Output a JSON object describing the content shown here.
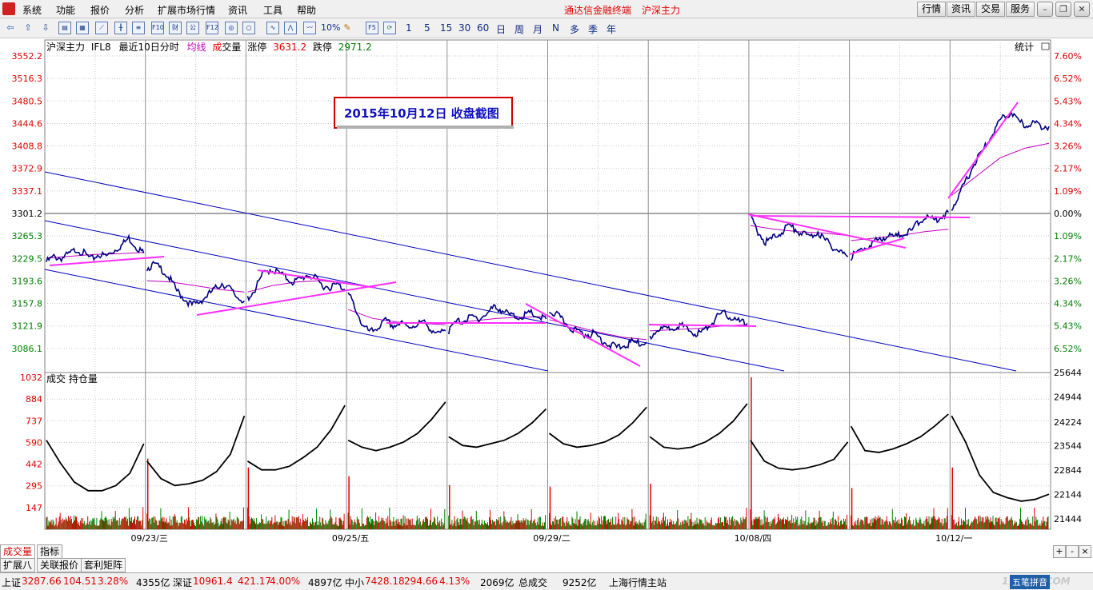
{
  "menu": {
    "items": [
      "系统",
      "功能",
      "报价",
      "分析",
      "扩展市场行情",
      "资讯",
      "工具",
      "帮助"
    ],
    "app_title": "通达信金融终端",
    "instrument_title": "沪深主力",
    "right_tabs": [
      "行情",
      "资讯",
      "交易",
      "服务"
    ]
  },
  "toolbar": {
    "icons": [
      "back-icon",
      "up-arrow-icon",
      "down-arrow-icon",
      "report-icon",
      "grid-icon",
      "trend-icon",
      "candlestick-icon",
      "f10-icon",
      "fin-icon",
      "formula-icon",
      "f12-icon",
      "xuan-icon",
      "tick-icon",
      "line-chart-icon",
      "mountain-chart-icon",
      "wave-chart-icon",
      "percent-icon",
      "pencil-icon",
      "f5-icon",
      "refresh-icon"
    ],
    "icon_text": {
      "f10": "F10",
      "fin": "财",
      "f11": "公",
      "f12": "F12",
      "percent": "10%",
      "f5": "F5"
    },
    "periods": [
      "1",
      "5",
      "15",
      "30",
      "60",
      "日",
      "周",
      "月",
      "N",
      "多",
      "季",
      "年"
    ]
  },
  "chart_header": {
    "name": "沪深主力",
    "code": "IFL8",
    "mode": "最近10日分时",
    "avg_label": "均线",
    "vol_label_1": "成",
    "vol_label_2": "交量",
    "limit_up_label": "涨停",
    "limit_up": "3631.2",
    "limit_down_label": "跌停",
    "limit_down": "2971.2",
    "stats_label": "统计"
  },
  "annotation": "2015年10月12日  收盘截图",
  "lower_header": "成交 持仓量",
  "tabs_bottom": [
    "成交量",
    "指标"
  ],
  "tabs_bottom2": [
    "扩展八",
    "关联报价",
    "套利矩阵"
  ],
  "scroll_buttons": [
    "+",
    "-",
    "×"
  ],
  "status": {
    "sh_label": "上证",
    "sh_value": "3287.66",
    "sh_change": "104.51",
    "sh_pct": "3.28%",
    "sh_amount": "4355亿",
    "sz_label": "深证",
    "sz_value": "10961.4",
    "sz_change": "421.17",
    "sz_pct": "4.00%",
    "sz_amount": "4897亿",
    "zx_label": "中小",
    "zx_value": "7428.18",
    "zx_change": "294.66",
    "zx_pct": "4.13%",
    "zx_amount": "2069亿",
    "total_label": "总成交",
    "total_amount": "9252亿",
    "server": "上海行情主站",
    "ime": "五笔拼音",
    "watermark": "178448.COM"
  },
  "colors": {
    "up": "#e00000",
    "down": "#008000",
    "price_line": "#000080",
    "avg_line": "#c000c0",
    "trend_line": "#ff30ff",
    "channel": "#0000c0"
  },
  "chart_data": {
    "type": "line",
    "price_axis": {
      "ticks": [
        "3552.2",
        "3516.3",
        "3480.5",
        "3444.6",
        "3408.8",
        "3372.9",
        "3337.1",
        "3301.2",
        "3265.3",
        "3229.5",
        "3193.6",
        "3157.8",
        "3121.9",
        "3086.1"
      ],
      "ylim": [
        3050.2,
        3552.2
      ],
      "reference": 3301.2
    },
    "pct_axis": {
      "ticks": [
        "7.60%",
        "6.52%",
        "5.43%",
        "4.34%",
        "3.26%",
        "2.17%",
        "1.09%",
        "0.00%",
        "1.09%",
        "2.17%",
        "3.26%",
        "4.34%",
        "5.43%",
        "6.52%"
      ]
    },
    "volume_axis": {
      "ticks": [
        "1032",
        "884",
        "737",
        "590",
        "442",
        "295",
        "147"
      ],
      "ylim": [
        0,
        1032
      ]
    },
    "oi_axis": {
      "ticks": [
        "25644",
        "24944",
        "24224",
        "23544",
        "22844",
        "22144",
        "21444"
      ],
      "ylim": [
        21144,
        25644
      ]
    },
    "x_labels": [
      "09/23/三",
      "09/25/五",
      "09/29/二",
      "10/08/四",
      "10/12/一"
    ],
    "days": [
      "09/22",
      "09/23",
      "09/24",
      "09/25",
      "09/28",
      "09/29",
      "09/30",
      "10/08",
      "10/09",
      "10/12"
    ],
    "series": [
      {
        "name": "price",
        "values": [
          [
            3224,
            3232,
            3230,
            3236,
            3244,
            3238,
            3228,
            3236,
            3233,
            3242,
            3250,
            3262,
            3248,
            3238
          ],
          [
            3214,
            3220,
            3212,
            3198,
            3178,
            3165,
            3155,
            3160,
            3170,
            3180,
            3190,
            3182,
            3168,
            3162
          ],
          [
            3166,
            3180,
            3204,
            3212,
            3208,
            3200,
            3192,
            3196,
            3204,
            3198,
            3186,
            3184,
            3188,
            3180
          ],
          [
            3174,
            3150,
            3120,
            3112,
            3120,
            3130,
            3122,
            3126,
            3120,
            3124,
            3128,
            3118,
            3108,
            3114
          ],
          [
            3114,
            3128,
            3130,
            3136,
            3134,
            3140,
            3152,
            3148,
            3140,
            3136,
            3138,
            3142,
            3136,
            3133
          ],
          [
            3146,
            3140,
            3128,
            3118,
            3112,
            3108,
            3110,
            3100,
            3092,
            3088,
            3090,
            3096,
            3094,
            3096
          ],
          [
            3102,
            3118,
            3116,
            3120,
            3124,
            3116,
            3110,
            3112,
            3124,
            3136,
            3142,
            3134,
            3128,
            3126
          ],
          [
            3295,
            3272,
            3255,
            3262,
            3270,
            3282,
            3276,
            3268,
            3264,
            3272,
            3258,
            3248,
            3240,
            3232
          ],
          [
            3232,
            3240,
            3248,
            3254,
            3262,
            3266,
            3264,
            3270,
            3272,
            3288,
            3296,
            3290,
            3296,
            3303
          ],
          [
            3310,
            3330,
            3355,
            3380,
            3398,
            3418,
            3440,
            3455,
            3462,
            3446,
            3442,
            3446,
            3440,
            3440
          ]
        ]
      },
      {
        "name": "average",
        "values": [
          [
            3230,
            3233,
            3236,
            3237,
            3239
          ],
          [
            3194,
            3192,
            3186,
            3180,
            3176
          ],
          [
            3176,
            3186,
            3192,
            3194,
            3190
          ],
          [
            3148,
            3134,
            3128,
            3126,
            3124
          ],
          [
            3126,
            3130,
            3134,
            3136,
            3137
          ],
          [
            3132,
            3122,
            3112,
            3104,
            3100
          ],
          [
            3114,
            3116,
            3118,
            3122,
            3124
          ],
          [
            3282,
            3276,
            3272,
            3270,
            3266
          ],
          [
            3258,
            3262,
            3266,
            3272,
            3276
          ],
          [
            3330,
            3360,
            3390,
            3405,
            3413
          ]
        ]
      },
      {
        "name": "open_interest",
        "values": [
          [
            23700,
            23050,
            22500,
            22250,
            22250,
            22400,
            22750,
            23600
          ],
          [
            23100,
            22600,
            22400,
            22450,
            22550,
            22800,
            23300,
            24400
          ],
          [
            23100,
            22850,
            22850,
            22950,
            23200,
            23500,
            24000,
            24700
          ],
          [
            23700,
            23500,
            23400,
            23500,
            23650,
            23900,
            24300,
            24800
          ],
          [
            23800,
            23550,
            23500,
            23600,
            23700,
            23900,
            24200,
            24600
          ],
          [
            23900,
            23600,
            23500,
            23550,
            23650,
            23850,
            24200,
            24650
          ],
          [
            23800,
            23500,
            23450,
            23500,
            23650,
            23900,
            24250,
            24750
          ],
          [
            23700,
            23100,
            22900,
            22850,
            22900,
            23000,
            23150,
            23650
          ],
          [
            24100,
            23400,
            23350,
            23450,
            23600,
            23800,
            24100,
            24450
          ],
          [
            24400,
            23650,
            22700,
            22200,
            22050,
            21950,
            22000,
            22150
          ]
        ]
      }
    ],
    "volume_spikes": [
      {
        "day": "09/23",
        "value": 480
      },
      {
        "day": "09/24",
        "value": 420
      },
      {
        "day": "09/25",
        "value": 360
      },
      {
        "day": "09/28",
        "value": 300
      },
      {
        "day": "09/29",
        "value": 290
      },
      {
        "day": "09/30",
        "value": 310
      },
      {
        "day": "10/08",
        "value": 1032
      },
      {
        "day": "10/09",
        "value": 280
      },
      {
        "day": "10/12",
        "value": 420
      }
    ]
  }
}
